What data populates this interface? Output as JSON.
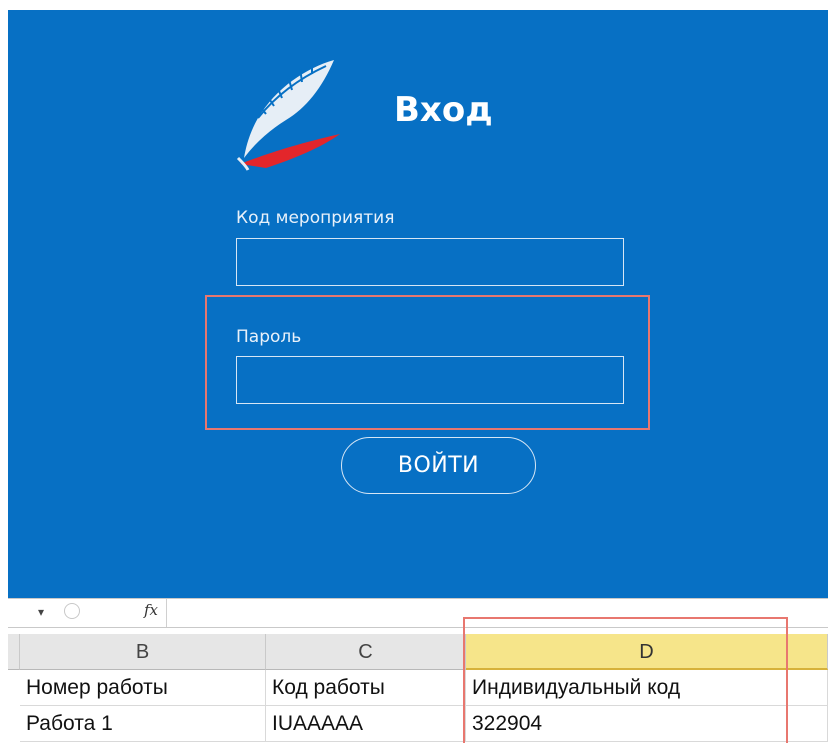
{
  "login": {
    "title": "Вход",
    "event_code_label": "Код мероприятия",
    "event_code_value": "",
    "password_label": "Пароль",
    "password_value": "",
    "submit_label": "ВОЙТИ",
    "colors": {
      "panel_bg": "#0770c4",
      "highlight": "#e8776f",
      "logo_red": "#e3262b"
    }
  },
  "formula_bar": {
    "fx_label": "fx"
  },
  "sheet": {
    "columns": [
      "B",
      "C",
      "D"
    ],
    "selected_column": "D",
    "rows": [
      [
        "Номер работы",
        "Код работы",
        "Индивидуальный код"
      ],
      [
        "Работа 1",
        "IUAAAAA",
        "322904"
      ]
    ]
  }
}
